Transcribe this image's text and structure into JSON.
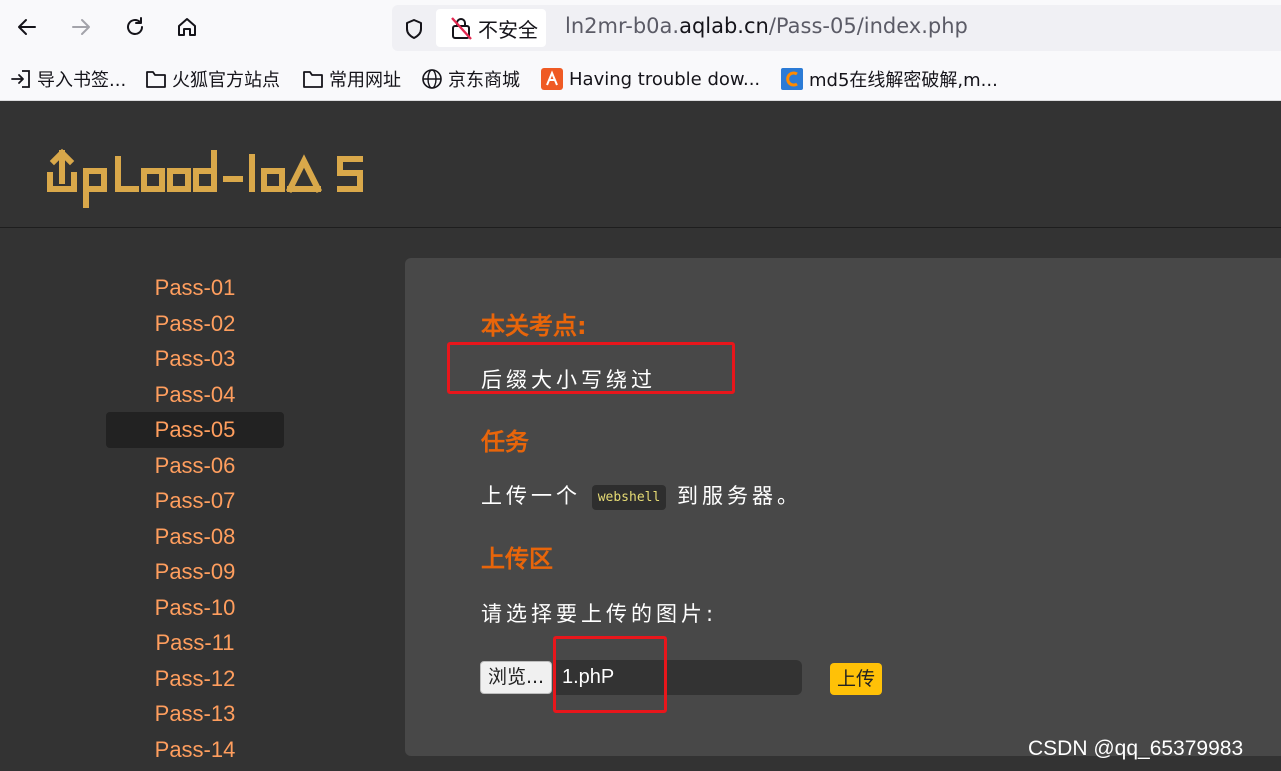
{
  "browser": {
    "security_label": "不安全",
    "url_prefix": "ln2mr-b0a.",
    "url_domain": "aqlab.cn",
    "url_path": "/Pass-05/index.php"
  },
  "bookmarks": [
    {
      "label": "导入书签...",
      "icon": "import-icon"
    },
    {
      "label": "火狐官方站点",
      "icon": "folder-icon"
    },
    {
      "label": "常用网址",
      "icon": "folder-icon"
    },
    {
      "label": "京东商城",
      "icon": "globe-icon"
    },
    {
      "label": "Having trouble dow...",
      "icon": "site-favicon"
    },
    {
      "label": "md5在线解密破解,m...",
      "icon": "site-favicon"
    }
  ],
  "site": {
    "logo_text": "UpLoad-labs"
  },
  "sidebar": {
    "items": [
      "Pass-01",
      "Pass-02",
      "Pass-03",
      "Pass-04",
      "Pass-05",
      "Pass-06",
      "Pass-07",
      "Pass-08",
      "Pass-09",
      "Pass-10",
      "Pass-11",
      "Pass-12",
      "Pass-13",
      "Pass-14"
    ],
    "active": "Pass-05"
  },
  "panel": {
    "topic_heading": "本关考点:",
    "topic_text": "后缀大小写绕过",
    "task_heading": "任务",
    "task_before": "上传一个",
    "task_code": "webshell",
    "task_after": "到服务器。",
    "upload_heading": "上传区",
    "choose_label": "请选择要上传的图片:",
    "browse_label": "浏览...",
    "file_name": "1.phP",
    "upload_button": "上传"
  },
  "watermark": "CSDN @qq_65379983",
  "colors": {
    "accent_orange": "#e8650a",
    "link_orange": "#ff9e5e",
    "logo_gold": "#d9a84a",
    "upload_yellow": "#ffc107",
    "highlight_red": "#e8161b"
  }
}
